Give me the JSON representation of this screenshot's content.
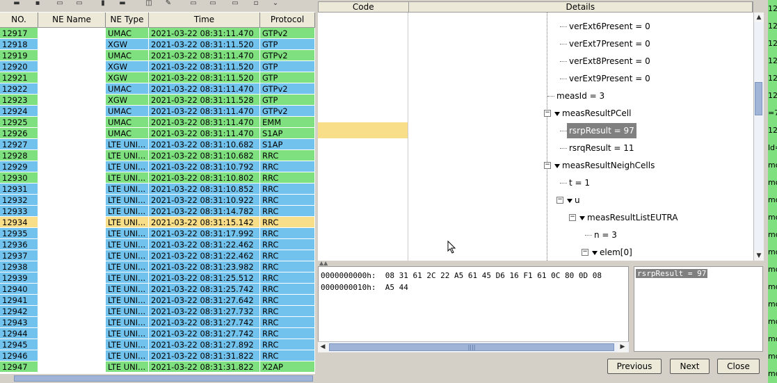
{
  "list": {
    "columns": [
      "NO.",
      "NE Name",
      "NE Type",
      "Time",
      "Protocol"
    ],
    "rows": [
      {
        "no": "12917",
        "type": "UMAC",
        "time": "2021-03-22 08:31:11.470",
        "proto": "GTPv2",
        "c": "g"
      },
      {
        "no": "12918",
        "type": "XGW",
        "time": "2021-03-22 08:31:11.520",
        "proto": "GTP",
        "c": "b"
      },
      {
        "no": "12919",
        "type": "UMAC",
        "time": "2021-03-22 08:31:11.470",
        "proto": "GTPv2",
        "c": "g"
      },
      {
        "no": "12920",
        "type": "XGW",
        "time": "2021-03-22 08:31:11.520",
        "proto": "GTP",
        "c": "b"
      },
      {
        "no": "12921",
        "type": "XGW",
        "time": "2021-03-22 08:31:11.520",
        "proto": "GTP",
        "c": "g"
      },
      {
        "no": "12922",
        "type": "UMAC",
        "time": "2021-03-22 08:31:11.470",
        "proto": "GTPv2",
        "c": "b"
      },
      {
        "no": "12923",
        "type": "XGW",
        "time": "2021-03-22 08:31:11.528",
        "proto": "GTP",
        "c": "g"
      },
      {
        "no": "12924",
        "type": "UMAC",
        "time": "2021-03-22 08:31:11.470",
        "proto": "GTPv2",
        "c": "b"
      },
      {
        "no": "12925",
        "type": "UMAC",
        "time": "2021-03-22 08:31:11.470",
        "proto": "EMM",
        "c": "g"
      },
      {
        "no": "12926",
        "type": "UMAC",
        "time": "2021-03-22 08:31:11.470",
        "proto": "S1AP",
        "c": "g"
      },
      {
        "no": "12927",
        "type": "LTE UNI...",
        "time": "2021-03-22 08:31:10.682",
        "proto": "S1AP",
        "c": "b"
      },
      {
        "no": "12928",
        "type": "LTE UNI...",
        "time": "2021-03-22 08:31:10.682",
        "proto": "RRC",
        "c": "g"
      },
      {
        "no": "12929",
        "type": "LTE UNI...",
        "time": "2021-03-22 08:31:10.792",
        "proto": "RRC",
        "c": "b"
      },
      {
        "no": "12930",
        "type": "LTE UNI...",
        "time": "2021-03-22 08:31:10.802",
        "proto": "RRC",
        "c": "g"
      },
      {
        "no": "12931",
        "type": "LTE UNI...",
        "time": "2021-03-22 08:31:10.852",
        "proto": "RRC",
        "c": "b"
      },
      {
        "no": "12932",
        "type": "LTE UNI...",
        "time": "2021-03-22 08:31:10.922",
        "proto": "RRC",
        "c": "b"
      },
      {
        "no": "12933",
        "type": "LTE UNI...",
        "time": "2021-03-22 08:31:14.782",
        "proto": "RRC",
        "c": "b"
      },
      {
        "no": "12934",
        "type": "LTE UNI...",
        "time": "2021-03-22 08:31:15.142",
        "proto": "RRC",
        "c": "y"
      },
      {
        "no": "12935",
        "type": "LTE UNI...",
        "time": "2021-03-22 08:31:17.992",
        "proto": "RRC",
        "c": "b"
      },
      {
        "no": "12936",
        "type": "LTE UNI...",
        "time": "2021-03-22 08:31:22.462",
        "proto": "RRC",
        "c": "b"
      },
      {
        "no": "12937",
        "type": "LTE UNI...",
        "time": "2021-03-22 08:31:22.462",
        "proto": "RRC",
        "c": "b"
      },
      {
        "no": "12938",
        "type": "LTE UNI...",
        "time": "2021-03-22 08:31:23.982",
        "proto": "RRC",
        "c": "b"
      },
      {
        "no": "12939",
        "type": "LTE UNI...",
        "time": "2021-03-22 08:31:25.512",
        "proto": "RRC",
        "c": "b"
      },
      {
        "no": "12940",
        "type": "LTE UNI...",
        "time": "2021-03-22 08:31:25.742",
        "proto": "RRC",
        "c": "b"
      },
      {
        "no": "12941",
        "type": "LTE UNI...",
        "time": "2021-03-22 08:31:27.642",
        "proto": "RRC",
        "c": "b"
      },
      {
        "no": "12942",
        "type": "LTE UNI...",
        "time": "2021-03-22 08:31:27.732",
        "proto": "RRC",
        "c": "b"
      },
      {
        "no": "12943",
        "type": "LTE UNI...",
        "time": "2021-03-22 08:31:27.742",
        "proto": "RRC",
        "c": "b"
      },
      {
        "no": "12944",
        "type": "LTE UNI...",
        "time": "2021-03-22 08:31:27.742",
        "proto": "RRC",
        "c": "b"
      },
      {
        "no": "12945",
        "type": "LTE UNI...",
        "time": "2021-03-22 08:31:27.892",
        "proto": "RRC",
        "c": "b"
      },
      {
        "no": "12946",
        "type": "LTE UNI...",
        "time": "2021-03-22 08:31:31.822",
        "proto": "RRC",
        "c": "b"
      },
      {
        "no": "12947",
        "type": "LTE UNI...",
        "time": "2021-03-22 08:31:31.822",
        "proto": "X2AP",
        "c": "g"
      }
    ]
  },
  "details": {
    "columns": [
      "Code",
      "Details"
    ],
    "tree": [
      {
        "label": "verExt6Present = 0"
      },
      {
        "label": "verExt7Present = 0"
      },
      {
        "label": "verExt8Present = 0"
      },
      {
        "label": "verExt9Present = 0"
      },
      {
        "label": "measId = 3"
      },
      {
        "label": "measResultPCell"
      },
      {
        "label": "rsrpResult = 97"
      },
      {
        "label": "rsrqResult = 11"
      },
      {
        "label": "measResultNeighCells"
      },
      {
        "label": "t = 1"
      },
      {
        "label": "u"
      },
      {
        "label": "measResultListEUTRA"
      },
      {
        "label": "n = 3"
      },
      {
        "label": "elem[0]"
      }
    ]
  },
  "hex": {
    "lines": [
      "0000000000h:  08 31 61 2C 22 A5 61 45 D6 16 F1 61 0C 80 0D 08",
      "0000000010h:  A5 44"
    ]
  },
  "decoded": "rsrpResult = 97",
  "buttons": {
    "previous": "Previous",
    "next": "Next",
    "close": "Close"
  },
  "edge": [
    "12",
    "12",
    "12",
    "12",
    "12",
    "12",
    "=7",
    "12",
    "ld=",
    "mo",
    "mo",
    "mo",
    "mo",
    "mo",
    "mo",
    "mo",
    "mo",
    "mo",
    "mo",
    "mo",
    "mo",
    "mo"
  ]
}
